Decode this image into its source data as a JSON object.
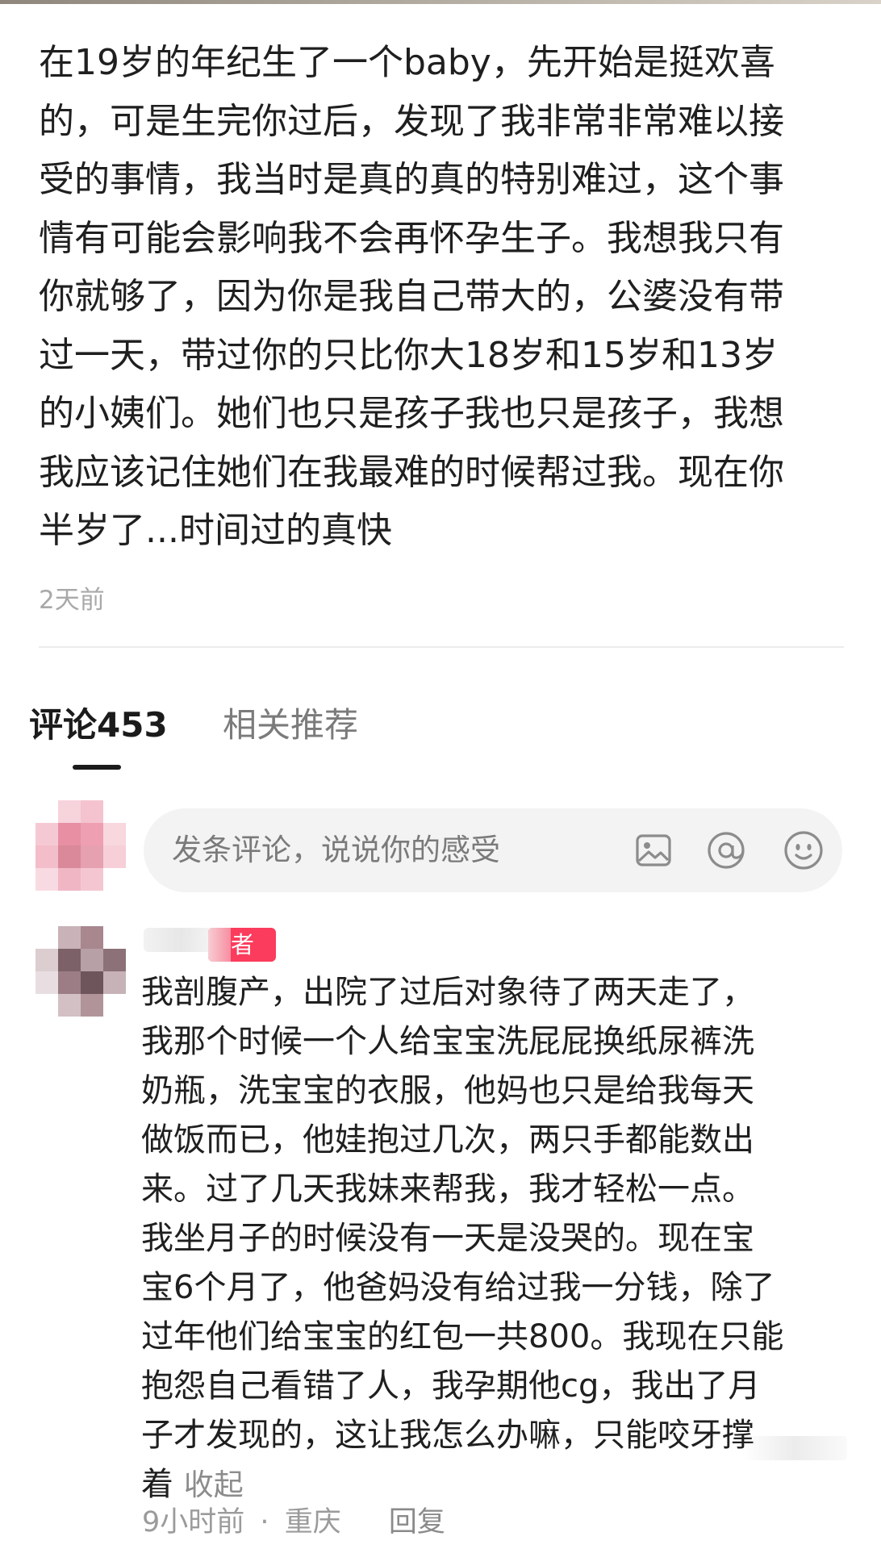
{
  "post": {
    "lines": [
      "在19岁的年纪生了一个baby，先开始是挺欢喜",
      "的，可是生完你过后，发现了我非常非常难以接",
      "受的事情，我当时是真的真的特别难过，这个事",
      "情有可能会影响我不会再怀孕生子。我想我只有",
      "你就够了，因为你是我自己带大的，公婆没有带",
      "过一天，带过你的只比你大18岁和15岁和13岁",
      "的小姨们。她们也只是孩子我也只是孩子，我想",
      "我应该记住她们在我最难的时候帮过我。现在你",
      "半岁了...时间过的真快"
    ],
    "time": "2天前"
  },
  "tabs": {
    "comments": "评论453",
    "related": "相关推荐"
  },
  "comment_box": {
    "placeholder": "发条评论，说说你的感受",
    "icons": [
      "image-icon",
      "at-icon",
      "emoji-icon"
    ]
  },
  "reply": {
    "badge": "者",
    "lines": [
      "我剖腹产，出院了过后对象待了两天走了，",
      "我那个时候一个人给宝宝洗屁屁换纸尿裤洗",
      "奶瓶，洗宝宝的衣服，他妈也只是给我每天",
      "做饭而已，他娃抱过几次，两只手都能数出",
      "来。过了几天我妹来帮我，我才轻松一点。",
      "我坐月子的时候没有一天是没哭的。现在宝",
      "宝6个月了，他爸妈没有给过我一分钱，除了",
      "过年他们给宝宝的红包一共800。我现在只能",
      "抱怨自己看错了人，我孕期他cg，我出了月",
      "子才发现的，这让我怎么办嘛，只能咬牙撑"
    ],
    "last_line": "着",
    "collapse": "收起",
    "time": "9小时前",
    "separator": "·",
    "location": "重庆",
    "reply_label": "回复"
  },
  "colors": {
    "badge": "#fb3c5c",
    "tab_active": "#1b1b1b",
    "muted": "#a9a9a9"
  }
}
